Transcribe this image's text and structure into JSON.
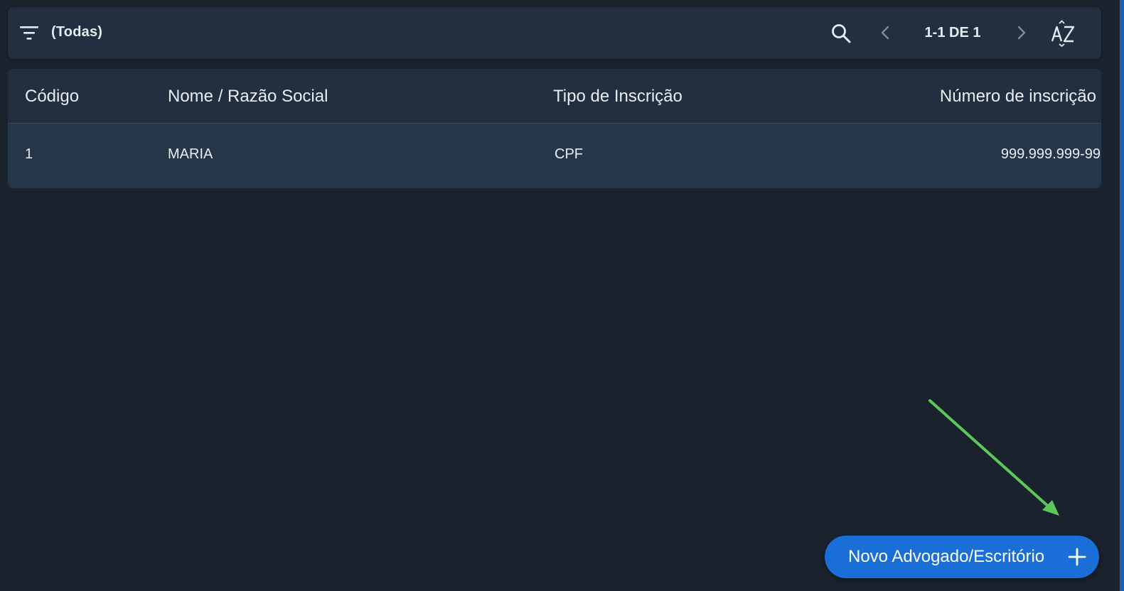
{
  "toolbar": {
    "filter_icon": "filter-list-icon",
    "filter_label": "(Todas)",
    "search_icon": "search-icon",
    "prev_icon": "chevron-left-icon",
    "pagination": "1-1 DE 1",
    "next_icon": "chevron-right-icon",
    "sort_icon": "sort-az-icon"
  },
  "table": {
    "columns": [
      "Código",
      "Nome / Razão Social",
      "Tipo de Inscrição",
      "Número de inscrição"
    ],
    "rows": [
      [
        "1",
        "MARIA",
        "CPF",
        "999.999.999-99"
      ]
    ]
  },
  "fab": {
    "label": "Novo Advogado/Escritório",
    "icon": "plus-icon"
  },
  "colors": {
    "background": "#19222d",
    "card": "#212f40",
    "row": "#263649",
    "primary": "#1a6ed8",
    "annotation_arrow": "#5cc85a"
  }
}
